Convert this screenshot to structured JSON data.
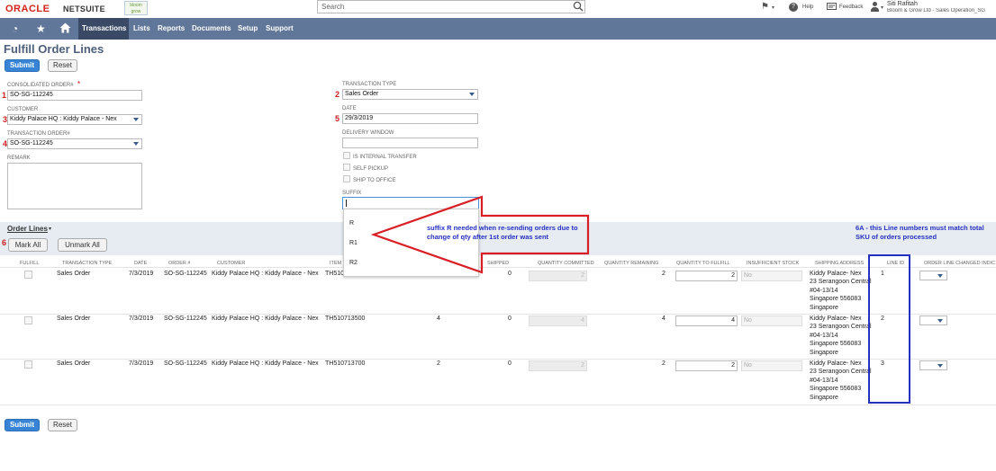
{
  "header": {
    "logo_oracle": "ORACLE",
    "logo_netsuite": "NETSUITE",
    "logo_brand": "bloom grow",
    "search_placeholder": "Search",
    "help_label": "Help",
    "feedback_label": "Feedback",
    "user_name": "Siti Rafitah",
    "user_role": "Bloom & Grow Ltd - Sales Operation_SG"
  },
  "nav": {
    "items": [
      "Transactions",
      "Lists",
      "Reports",
      "Documents",
      "Setup",
      "Support"
    ]
  },
  "page": {
    "title": "Fulfill Order Lines",
    "submit_label": "Submit",
    "reset_label": "Reset"
  },
  "form": {
    "consolidated_order_label": "CONSOLIDATED ORDER#",
    "consolidated_order_required": "*",
    "consolidated_order_value": "SO-SG-112245",
    "customer_label": "CUSTOMER",
    "customer_value": "Kiddy Palace HQ : Kiddy Palace - Nex",
    "transaction_order_label": "TRANSACTION ORDER#",
    "transaction_order_value": "SO-SG-112245",
    "remark_label": "REMARK",
    "transaction_type_label": "TRANSACTION TYPE",
    "transaction_type_value": "Sales Order",
    "date_label": "DATE",
    "date_value": "29/3/2019",
    "delivery_window_label": "DELIVERY WINDOW",
    "is_internal_transfer_label": "IS INTERNAL TRANSFER",
    "self_pickup_label": "SELF PICKUP",
    "ship_to_office_label": "SHIP TO OFFICE",
    "suffix_label": "SUFFIX",
    "suffix_options": [
      "R",
      "R1",
      "R2"
    ]
  },
  "annotations": {
    "n1": "1",
    "n2": "2",
    "n3": "3",
    "n4": "4",
    "n5": "5",
    "n6": "6",
    "suffix_note": "suffix R needed when re-sending orders due to change of qty after 1st order was sent",
    "line_note": "6A - this Line numbers must match total SKU of orders processed"
  },
  "sublist": {
    "title": "Order Lines",
    "mark_all": "Mark All",
    "unmark_all": "Unmark All",
    "columns": {
      "fulfill": "FULFILL",
      "transaction_type": "TRANSACTION TYPE",
      "date": "DATE",
      "order": "ORDER #",
      "customer": "CUSTOMER",
      "item": "ITEM",
      "shipped": "SHIPPED",
      "qty_committed": "QUANTITY COMMITTED",
      "qty_remaining": "QUANTITY REMAINING",
      "qty_to_fulfill": "QUANTITY TO FULFILL",
      "insufficient_stock": "INSUFFICIENT STOCK",
      "shipping_address": "SHIPPING ADDRESS",
      "line_id": "LINE ID",
      "line_changed": "ORDER LINE CHANGED INDIC"
    },
    "rows": [
      {
        "type": "Sales Order",
        "date": "7/3/2019",
        "order": "SO-SG-112245",
        "customer": "Kiddy Palace HQ : Kiddy Palace - Nex",
        "item": "TH510",
        "ordered": "",
        "shipped": "0",
        "committed": "2",
        "remaining": "2",
        "to_fulfill": "2",
        "insufficient": "No",
        "addr1": "Kiddy Palace- Nex",
        "addr2": "23 Serangoon Central",
        "addr3": "#04-13/14",
        "addr4": "Singapore 556083",
        "addr5": "Singapore",
        "line_id": "1"
      },
      {
        "type": "Sales Order",
        "date": "7/3/2019",
        "order": "SO-SG-112245",
        "customer": "Kiddy Palace HQ : Kiddy Palace - Nex",
        "item": "TH510713500",
        "ordered": "4",
        "shipped": "0",
        "committed": "4",
        "remaining": "4",
        "to_fulfill": "4",
        "insufficient": "No",
        "addr1": "Kiddy Palace- Nex",
        "addr2": "23 Serangoon Central",
        "addr3": "#04-13/14",
        "addr4": "Singapore 556083",
        "addr5": "Singapore",
        "line_id": "2"
      },
      {
        "type": "Sales Order",
        "date": "7/3/2019",
        "order": "SO-SG-112245",
        "customer": "Kiddy Palace HQ : Kiddy Palace - Nex",
        "item": "TH510713700",
        "ordered": "2",
        "shipped": "0",
        "committed": "2",
        "remaining": "2",
        "to_fulfill": "2",
        "insufficient": "No",
        "addr1": "Kiddy Palace- Nex",
        "addr2": "23 Serangoon Central",
        "addr3": "#04-13/14",
        "addr4": "Singapore 556083",
        "addr5": "Singapore",
        "line_id": "3"
      }
    ]
  },
  "colors": {
    "nav_bg": "#607799",
    "primary_button": "#3784d6",
    "annotation_red": "#d81f26",
    "annotation_blue": "#2530c0"
  }
}
